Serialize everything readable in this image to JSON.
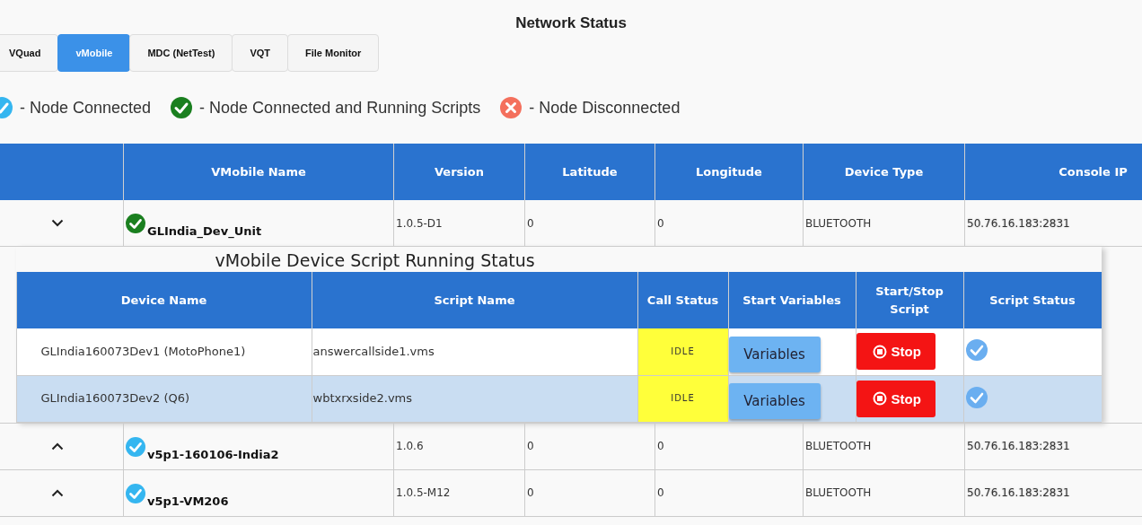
{
  "title": "Network Status",
  "tabs": [
    {
      "label": "VQuad",
      "selected": false
    },
    {
      "label": "vMobile",
      "selected": true
    },
    {
      "label": "MDC (NetTest)",
      "selected": false
    },
    {
      "label": "VQT",
      "selected": false
    },
    {
      "label": "File Monitor",
      "selected": false
    }
  ],
  "legend": [
    {
      "connected": true,
      "color": "#35b6f0",
      "label": "- Node Connected"
    },
    {
      "connected": true,
      "color": "#1a7f1f",
      "label": "- Node Connected and Running Scripts"
    },
    {
      "connected": false,
      "color": "#f4705d",
      "label": "- Node Disconnected"
    }
  ],
  "table": {
    "columns": [
      "VMobile Name",
      "Version",
      "Latitude",
      "Longitude",
      "Device Type",
      "Console IP"
    ],
    "rows": [
      {
        "expanded": true,
        "connected": true,
        "color": "#1a7f1f",
        "name": "GLIndia_Dev_Unit",
        "version": "1.0.5-D1",
        "latitude": "0",
        "longitude": "0",
        "device_type": "BLUETOOTH",
        "console_ip": "50.76.16.183:2831",
        "details": {
          "title": "vMobile Device Script Running Status",
          "columns": [
            "Device Name",
            "Script Name",
            "Call Status",
            "Start Variables",
            "Start/Stop Script",
            "Script Status"
          ],
          "rows": [
            {
              "selected": false,
              "device": "GLIndia160073Dev1 (MotoPhone1)",
              "script": "answercallside1.vms",
              "call_status": "IDLE",
              "variables_button": "Variables",
              "stop_button": "Stop",
              "script_running": true
            },
            {
              "selected": true,
              "device": "GLIndia160073Dev2 (Q6)",
              "script": "wbtxrxside2.vms",
              "call_status": "IDLE",
              "variables_button": "Variables",
              "stop_button": "Stop",
              "script_running": true
            }
          ]
        }
      },
      {
        "expanded": false,
        "connected": true,
        "color": "#35b6f0",
        "name": "v5p1-160106-India2",
        "version": "1.0.6",
        "latitude": "0",
        "longitude": "0",
        "device_type": "BLUETOOTH",
        "console_ip": "50.76.16.183:2831"
      },
      {
        "expanded": false,
        "connected": true,
        "color": "#35b6f0",
        "name": "v5p1-VM206",
        "version": "1.0.5-M12",
        "latitude": "0",
        "longitude": "0",
        "device_type": "BLUETOOTH",
        "console_ip": "50.76.16.183:2831"
      }
    ]
  }
}
